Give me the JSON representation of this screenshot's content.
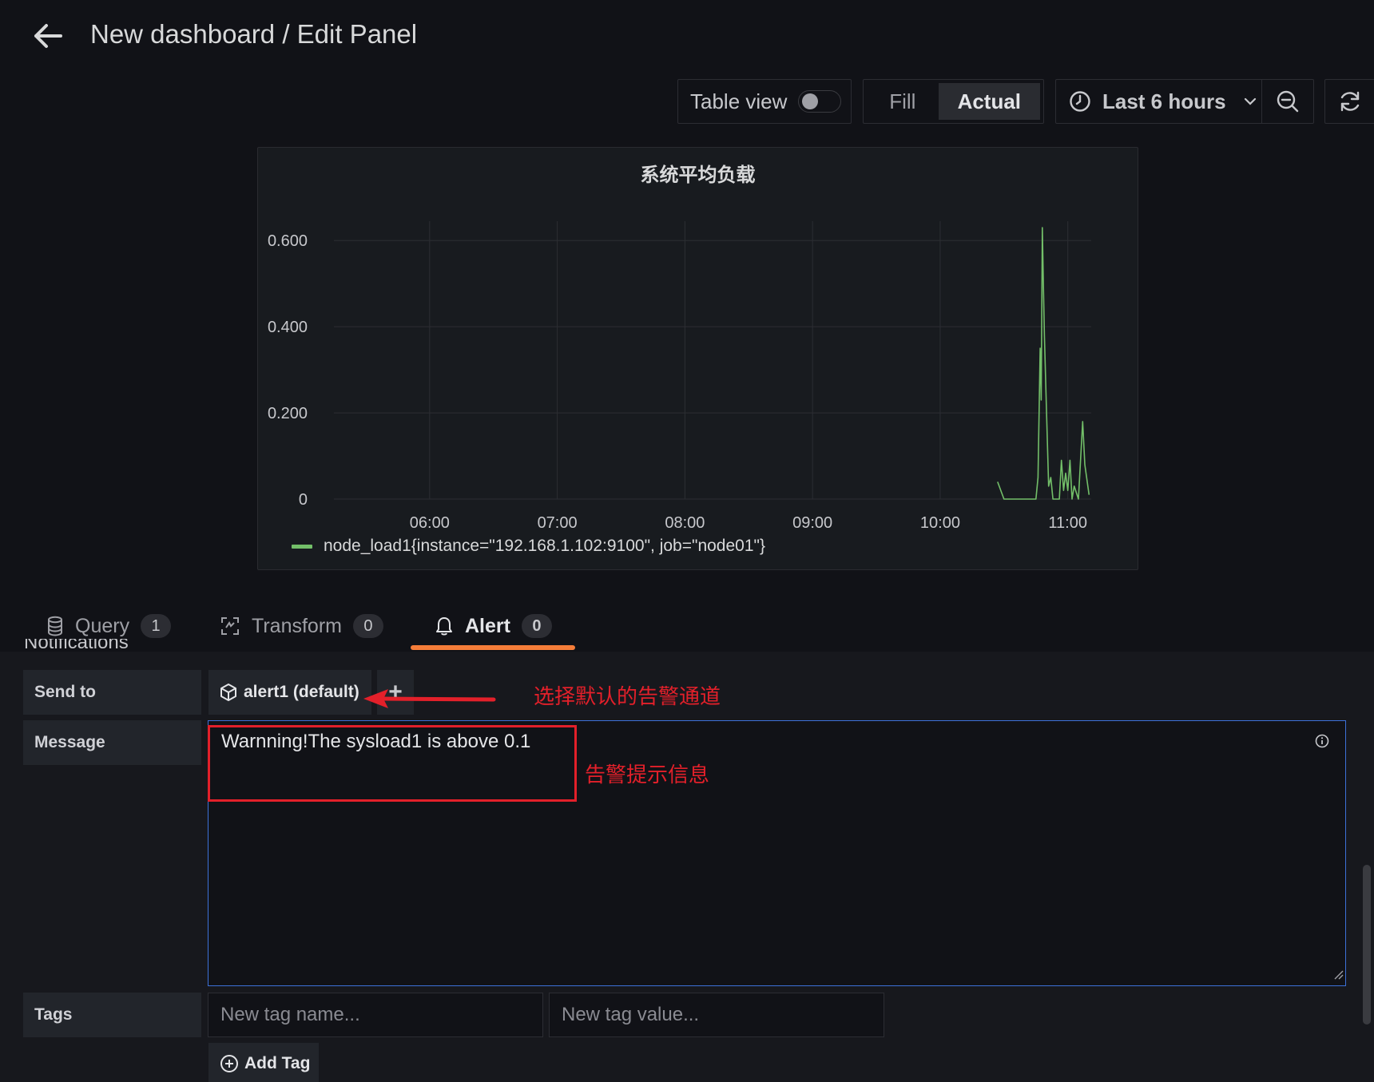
{
  "header": {
    "title": "New dashboard / Edit Panel"
  },
  "toolbar": {
    "table_view_label": "Table view",
    "table_view_on": false,
    "fill_label": "Fill",
    "actual_label": "Actual",
    "time_range_label": "Last 6 hours"
  },
  "panel": {
    "title": "系统平均负载",
    "legend": "node_load1{instance=\"192.168.1.102:9100\", job=\"node01\"}",
    "series_color": "#73bf69"
  },
  "chart_data": {
    "type": "line",
    "title": "系统平均负载",
    "xlabel": "",
    "ylabel": "",
    "x_ticks": [
      "06:00",
      "07:00",
      "08:00",
      "09:00",
      "10:00",
      "11:00"
    ],
    "y_ticks": [
      "0",
      "0.200",
      "0.400",
      "0.600"
    ],
    "ylim": [
      0,
      0.63
    ],
    "xlim": [
      "05:15",
      "11:11"
    ],
    "grid": true,
    "legend_placement": "bottom-left",
    "series": [
      {
        "name": "node_load1{instance=\"192.168.1.102:9100\", job=\"node01\"}",
        "points": [
          [
            "10:27",
            0.04
          ],
          [
            "10:30",
            0.0
          ],
          [
            "10:38",
            0.0
          ],
          [
            "10:45",
            0.0
          ],
          [
            "10:46",
            0.05
          ],
          [
            "10:47",
            0.35
          ],
          [
            "10:47:30",
            0.23
          ],
          [
            "10:48",
            0.63
          ],
          [
            "10:48:30",
            0.5
          ],
          [
            "10:49",
            0.38
          ],
          [
            "10:50",
            0.2
          ],
          [
            "10:51",
            0.03
          ],
          [
            "10:52",
            0.05
          ],
          [
            "10:53",
            0.0
          ],
          [
            "10:56",
            0.0
          ],
          [
            "10:57",
            0.09
          ],
          [
            "10:58",
            0.02
          ],
          [
            "10:59",
            0.06
          ],
          [
            "11:00",
            0.02
          ],
          [
            "11:01",
            0.09
          ],
          [
            "11:02",
            0.0
          ],
          [
            "11:03",
            0.03
          ],
          [
            "11:05",
            0.0
          ],
          [
            "11:07",
            0.18
          ],
          [
            "11:08",
            0.08
          ],
          [
            "11:10",
            0.01
          ]
        ]
      }
    ]
  },
  "tabs": [
    {
      "label": "Query",
      "count": "1"
    },
    {
      "label": "Transform",
      "count": "0"
    },
    {
      "label": "Alert",
      "count": "0"
    }
  ],
  "section_heading_partial": "Notifications",
  "form": {
    "send_to_label": "Send to",
    "send_to_value": "alert1 (default)",
    "add_button": "+",
    "message_label": "Message",
    "message_value": "Warnning!The sysload1 is above 0.1",
    "tags_label": "Tags",
    "tag_name_placeholder": "New tag name...",
    "tag_value_placeholder": "New tag value...",
    "add_tag_label": "Add Tag"
  },
  "annotations": {
    "send_to_note": "选择默认的告警通道",
    "message_note": "告警提示信息",
    "color": "#e3202a"
  }
}
